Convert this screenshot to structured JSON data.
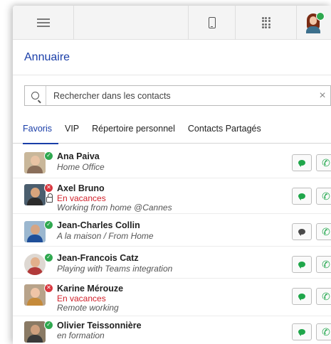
{
  "toolbar": {
    "menu_icon": "hamburger-icon",
    "phone_icon": "mobile-phone-icon",
    "dialpad_icon": "dialpad-icon",
    "user_icon": "user-avatar-icon"
  },
  "page": {
    "title": "Annuaire"
  },
  "search": {
    "placeholder": "Rechercher dans les contacts",
    "value": "",
    "clear_label": "×"
  },
  "tabs": [
    {
      "label": "Favoris",
      "active": true
    },
    {
      "label": "VIP",
      "active": false
    },
    {
      "label": "Répertoire personnel",
      "active": false
    },
    {
      "label": "Contacts Partagés",
      "active": false
    }
  ],
  "contacts": [
    {
      "name": "Ana Paiva",
      "line2": "Home Office",
      "line3": "",
      "status": "available",
      "status_mark": "✓",
      "chat_enabled": true
    },
    {
      "name": "Axel Bruno",
      "line2": "En vacances",
      "line3": "Working from home @Cannes",
      "status": "busy",
      "status_mark": "✕",
      "chat_enabled": true,
      "locked": true
    },
    {
      "name": "Jean-Charles Collin",
      "line2": "A la maison / From Home",
      "line3": "",
      "status": "available",
      "status_mark": "✓",
      "chat_enabled": false
    },
    {
      "name": "Jean-Francois Catz",
      "line2": "Playing with Teams integration",
      "line3": "",
      "status": "available",
      "status_mark": "✓",
      "chat_enabled": true
    },
    {
      "name": "Karine Mérouze",
      "line2": "En vacances",
      "line3": "Remote working",
      "status": "busy",
      "status_mark": "✕",
      "chat_enabled": true
    },
    {
      "name": "Olivier Teissonnière",
      "line2": "en formation",
      "line3": "",
      "status": "available",
      "status_mark": "✓",
      "chat_enabled": true
    }
  ],
  "colors": {
    "accent": "#1a3ea8",
    "available": "#2fa84f",
    "busy": "#d9363e",
    "away_text": "#d0202a"
  },
  "call_glyph": "✆"
}
